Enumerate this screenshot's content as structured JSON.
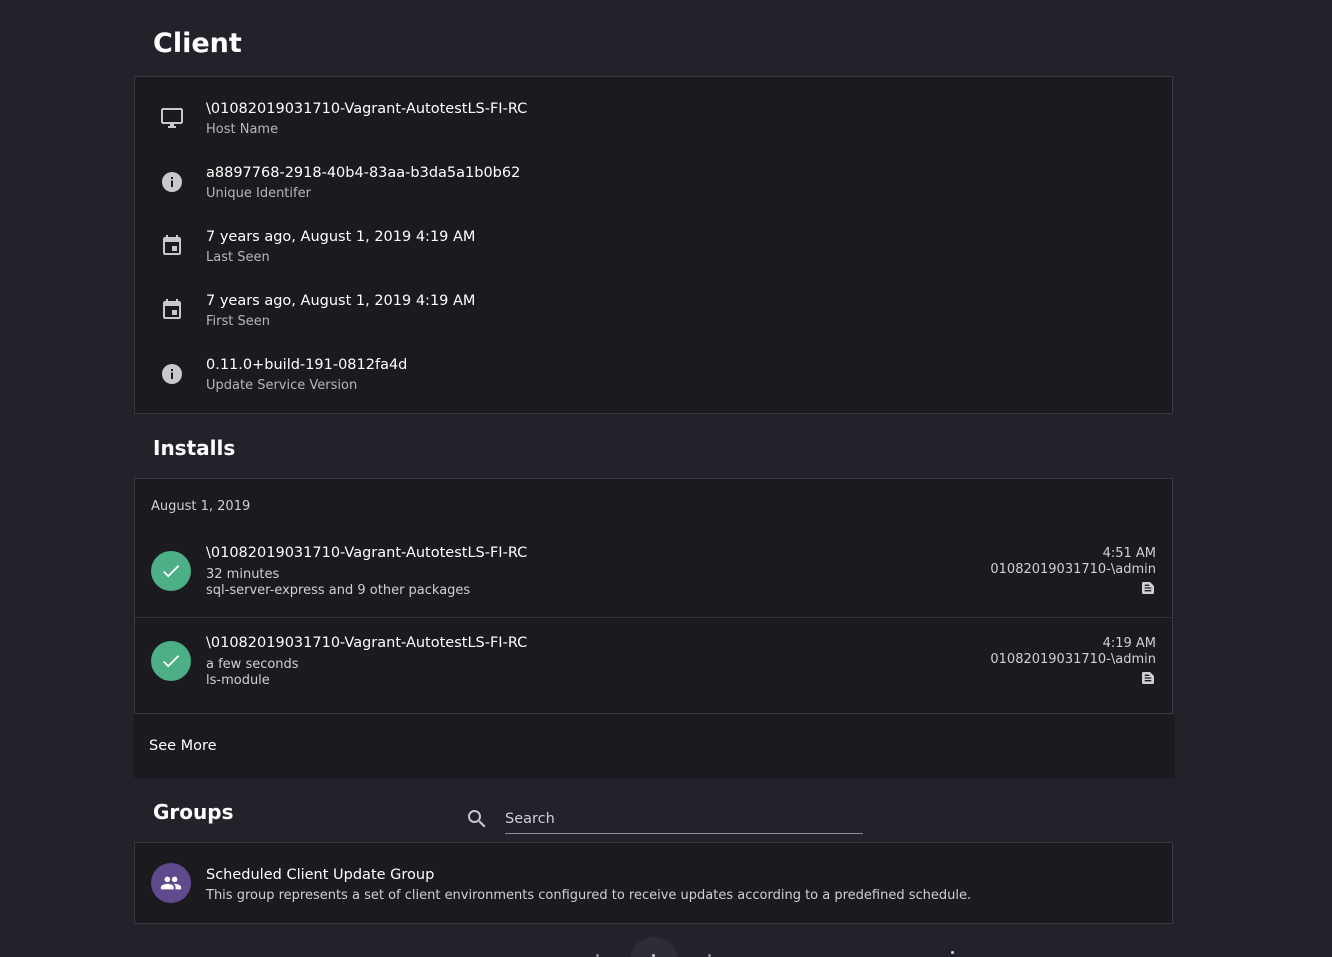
{
  "client": {
    "title": "Client",
    "rows": [
      {
        "icon": "monitor-icon",
        "value": "\\01082019031710-Vagrant-AutotestLS-FI-RC",
        "label": "Host Name"
      },
      {
        "icon": "info-icon",
        "value": "a8897768-2918-40b4-83aa-b3da5a1b0b62",
        "label": "Unique Identifer"
      },
      {
        "icon": "calendar-icon",
        "value": "7 years ago, August 1, 2019 4:19 AM",
        "label": "Last Seen"
      },
      {
        "icon": "calendar-icon",
        "value": "7 years ago, August 1, 2019 4:19 AM",
        "label": "First Seen"
      },
      {
        "icon": "info-icon",
        "value": "0.11.0+build-191-0812fa4d",
        "label": "Update Service Version"
      }
    ]
  },
  "installs": {
    "title": "Installs",
    "date_header": "August 1, 2019",
    "items": [
      {
        "host": "\\01082019031710-Vagrant-AutotestLS-FI-RC",
        "duration": "32 minutes",
        "packages": "sql-server-express and 9 other packages",
        "time": "4:51 AM",
        "user": "01082019031710-\\admin",
        "status": "success"
      },
      {
        "host": "\\01082019031710-Vagrant-AutotestLS-FI-RC",
        "duration": "a few seconds",
        "packages": "ls-module",
        "time": "4:19 AM",
        "user": "01082019031710-\\admin",
        "status": "success"
      }
    ],
    "see_more_label": "See More"
  },
  "groups": {
    "title": "Groups",
    "search": {
      "placeholder": "Search",
      "value": ""
    },
    "items": [
      {
        "name": "Scheduled Client Update Group",
        "description": "This group represents a set of client environments configured to receive updates according to a predefined schedule."
      }
    ]
  },
  "colors": {
    "background": "#23222b",
    "card": "#1b1b1f",
    "success": "#4caf85",
    "group_avatar": "#5e4a8c"
  }
}
